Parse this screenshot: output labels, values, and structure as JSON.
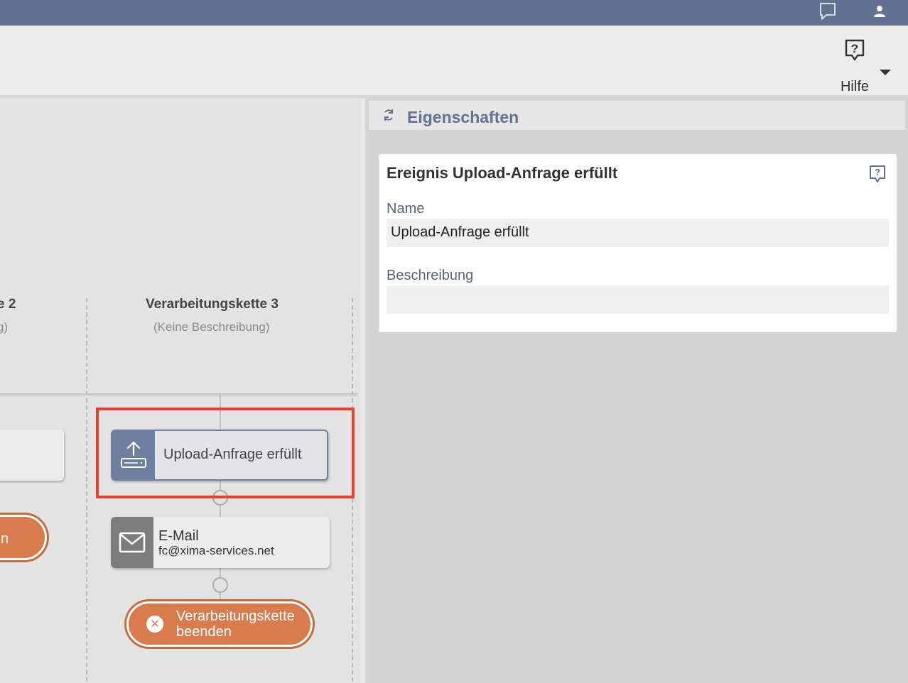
{
  "topbar": {
    "icons": [
      "chat-icon",
      "user-icon"
    ],
    "color": "#637291"
  },
  "toolbar": {
    "help_label": "Hilfe"
  },
  "canvas": {
    "lanes": [
      {
        "title": "e 2",
        "description": "g)"
      },
      {
        "title": "Verarbeitungskette 3",
        "description": "(Keine Beschreibung)"
      }
    ],
    "nodes": {
      "upload": {
        "label": "Upload-Anfrage erfüllt"
      },
      "mail": {
        "title": "E-Mail",
        "detail": "fc@xima-services.net"
      },
      "end": {
        "line1": "Verarbeitungskette",
        "line2": "beenden"
      },
      "left_pill": {
        "label": "n"
      }
    },
    "accent_color": "#d87c4e",
    "highlight_color": "#e8412f"
  },
  "panel": {
    "header_title": "Eigenschaften",
    "card": {
      "title": "Ereignis Upload-Anfrage erfüllt",
      "name_label": "Name",
      "name_value": "Upload-Anfrage erfüllt",
      "description_label": "Beschreibung",
      "description_value": ""
    }
  }
}
